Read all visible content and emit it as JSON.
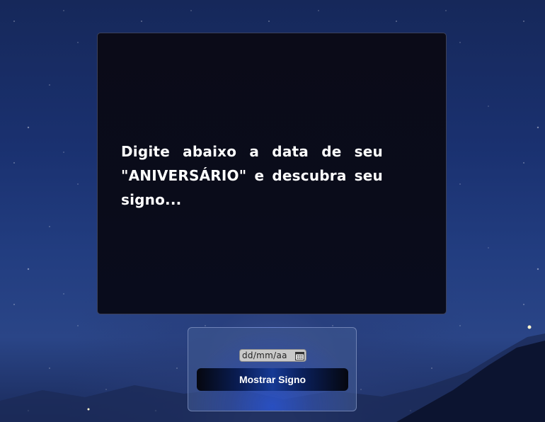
{
  "intro": {
    "text": "Digite abaixo a data de seu \"ANIVERSÁRIO\" e descubra seu signo..."
  },
  "form": {
    "date_placeholder": "dd/mm/aa",
    "date_icon": "calendar-icon",
    "button_label": "Mostrar Signo"
  },
  "colors": {
    "panel_background": "#0b0b18",
    "button_center": "#163a95",
    "sky": "#1a3170"
  }
}
